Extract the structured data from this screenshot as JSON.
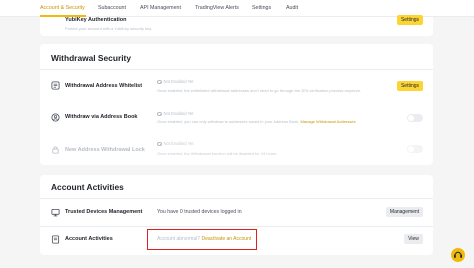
{
  "nav": {
    "tabs": [
      {
        "label": "Account & Security"
      },
      {
        "label": "Subaccount"
      },
      {
        "label": "API Management"
      },
      {
        "label": "TradingView Alerts"
      },
      {
        "label": "Settings"
      },
      {
        "label": "Audit"
      }
    ]
  },
  "yubikey": {
    "label": "YubiKey Authentication",
    "desc": "Protect your account with a YubiKey security key.",
    "button": "Settings"
  },
  "withdrawal_security": {
    "title": "Withdrawal Security",
    "rows": [
      {
        "label": "Withdrawal Address Whitelist",
        "status": "Not Enabled Yet",
        "desc": "Once enabled, the whitelisted withdrawal addresses don't need to go through the 2FA verification process anymore.",
        "button": "Settings"
      },
      {
        "label": "Withdraw via Address Book",
        "status": "Not Enabled Yet",
        "desc": "Once enabled, you can only withdraw to addresses saved in your Address Book.",
        "link": "Manage Withdrawal Addresses"
      },
      {
        "label": "New Address Withdrawal Lock",
        "status": "Not Enabled Yet",
        "desc": "Once enabled, the Withdrawal function will be disabled for 24 hours"
      }
    ]
  },
  "account_activities": {
    "title": "Account Activities",
    "rows": [
      {
        "label": "Trusted Devices Management",
        "text": "You have 0 trusted devices logged in",
        "button": "Management"
      },
      {
        "label": "Account Activities",
        "question": "Account abnormal?",
        "link": "Deactivate an Account",
        "button": "View"
      }
    ]
  },
  "colors": {
    "accent": "#f0b90b",
    "link": "#c99400",
    "highlight_box": "#e02020"
  }
}
